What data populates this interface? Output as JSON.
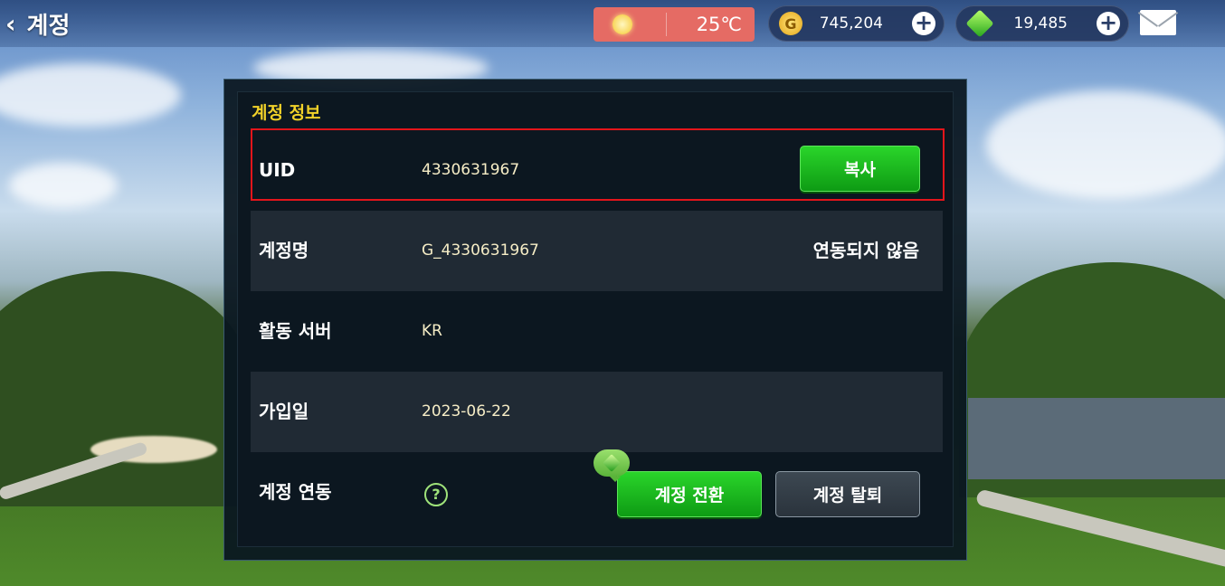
{
  "header": {
    "back_label": "계정",
    "temperature": "25℃",
    "gold": "745,204",
    "gold_icon_letter": "G",
    "gems": "19,485",
    "plus_symbol": "+"
  },
  "account_info": {
    "section_title": "계정 정보",
    "rows": [
      {
        "label": "UID",
        "value": "4330631967",
        "button": "복사"
      },
      {
        "label": "계정명",
        "value": "G_4330631967",
        "status": "연동되지 않음"
      },
      {
        "label": "활동 서버",
        "value": "KR"
      },
      {
        "label": "가입일",
        "value": "2023-06-22"
      },
      {
        "label": "계정 연동",
        "help": "?",
        "switch_button": "계정 전환",
        "delete_button": "계정 탈퇴"
      }
    ]
  },
  "colors": {
    "title_yellow": "#f2d229",
    "highlight_red": "#e3151b",
    "button_green": "#1cb81f"
  }
}
